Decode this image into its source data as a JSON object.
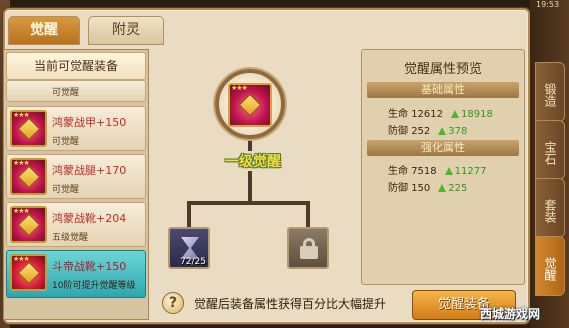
{
  "tabs": {
    "active": "觉醒",
    "inactive": "附灵"
  },
  "list": {
    "header": "当前可觉醒装备",
    "items": [
      {
        "name": "",
        "sub": "可觉醒"
      },
      {
        "name": "鸿蒙战甲+150",
        "sub": "可觉醒"
      },
      {
        "name": "鸿蒙战腿+170",
        "sub": "可觉醒"
      },
      {
        "name": "鸿蒙战靴+204",
        "sub": "五级觉醒"
      },
      {
        "name": "斗帝战靴+150",
        "sub": "10阶可提升觉醒等级"
      }
    ]
  },
  "tree": {
    "tier_label": "一级觉醒",
    "child_count": "72/25"
  },
  "preview": {
    "title": "觉醒属性预览",
    "section1": {
      "title": "基础属性",
      "rows": [
        {
          "label": "生命",
          "value": "12612",
          "new": "18918"
        },
        {
          "label": "防御",
          "value": "252",
          "new": "378"
        }
      ]
    },
    "section2": {
      "title": "强化属性",
      "rows": [
        {
          "label": "生命",
          "value": "7518",
          "new": "11277"
        },
        {
          "label": "防御",
          "value": "150",
          "new": "225"
        }
      ]
    }
  },
  "hint": {
    "icon_text": "?",
    "text": "觉醒后装备属性获得百分比大幅提升"
  },
  "button": {
    "label": "觉醒装备"
  },
  "right_tabs": [
    "锻造",
    "宝石",
    "套装",
    "觉醒"
  ],
  "status_time": "19:53",
  "watermark": "西城游戏网",
  "colors": {
    "accent": "#d27d16",
    "selected_item": "#2fa6b0",
    "increase": "#2f9a1c",
    "item_name": "#c12a2a"
  }
}
